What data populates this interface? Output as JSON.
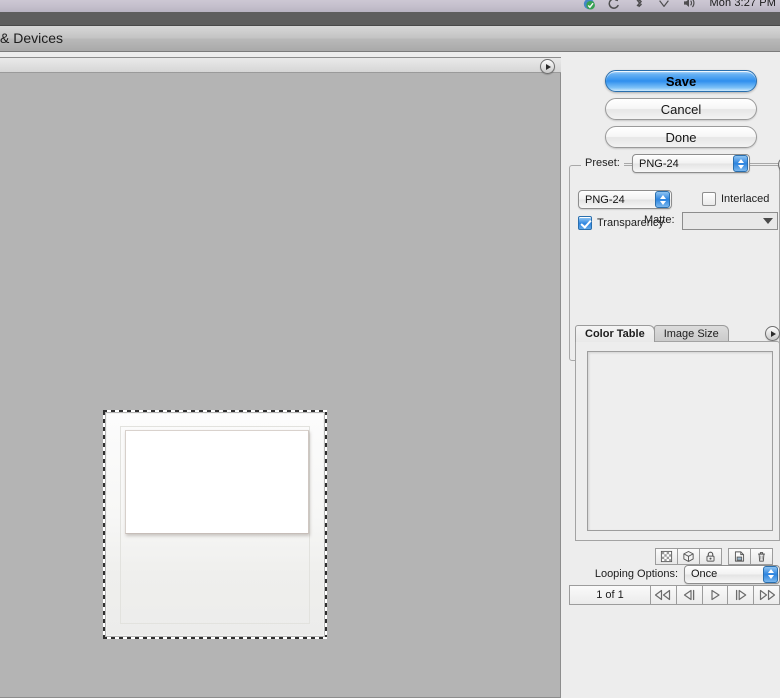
{
  "menubar": {
    "clock": "Mon 3:27 PM",
    "icons": [
      {
        "name": "dropbox-status-icon"
      },
      {
        "name": "sync-icon"
      },
      {
        "name": "bluetooth-icon"
      },
      {
        "name": "eject-icon"
      },
      {
        "name": "volume-icon"
      }
    ]
  },
  "window": {
    "title": "& Devices"
  },
  "preview": {
    "menu_button": "panel-menu",
    "canvas_background": "#b4b4b4",
    "artwork_name": "polaroid-frame-image"
  },
  "buttons": {
    "save": "Save",
    "cancel": "Cancel",
    "done": "Done"
  },
  "settings": {
    "preset_label": "Preset:",
    "preset_value": "PNG-24",
    "format_value": "PNG-24",
    "transparency_label": "Transparency",
    "transparency_checked": true,
    "interlaced_label": "Interlaced",
    "interlaced_checked": false,
    "matte_label": "Matte:",
    "matte_value": ""
  },
  "color_table": {
    "tabs": [
      {
        "label": "Color Table",
        "active": true
      },
      {
        "label": "Image Size",
        "active": false
      }
    ],
    "swatch_count": 0,
    "toolbar": [
      {
        "name": "transparency-swatch-button"
      },
      {
        "name": "web-shift-cube-button"
      },
      {
        "name": "lock-color-button"
      },
      {
        "name": "new-color-button"
      },
      {
        "name": "delete-color-button"
      }
    ]
  },
  "animation": {
    "looping_label": "Looping Options:",
    "looping_value": "Once",
    "frame_count": "1 of 1",
    "transport": [
      {
        "name": "first-frame-button"
      },
      {
        "name": "previous-frame-button"
      },
      {
        "name": "play-button"
      },
      {
        "name": "next-frame-button"
      },
      {
        "name": "last-frame-button"
      }
    ]
  },
  "colors": {
    "accent": "#2f86e0",
    "canvas": "#b4b4b4",
    "panel": "#ededed"
  }
}
